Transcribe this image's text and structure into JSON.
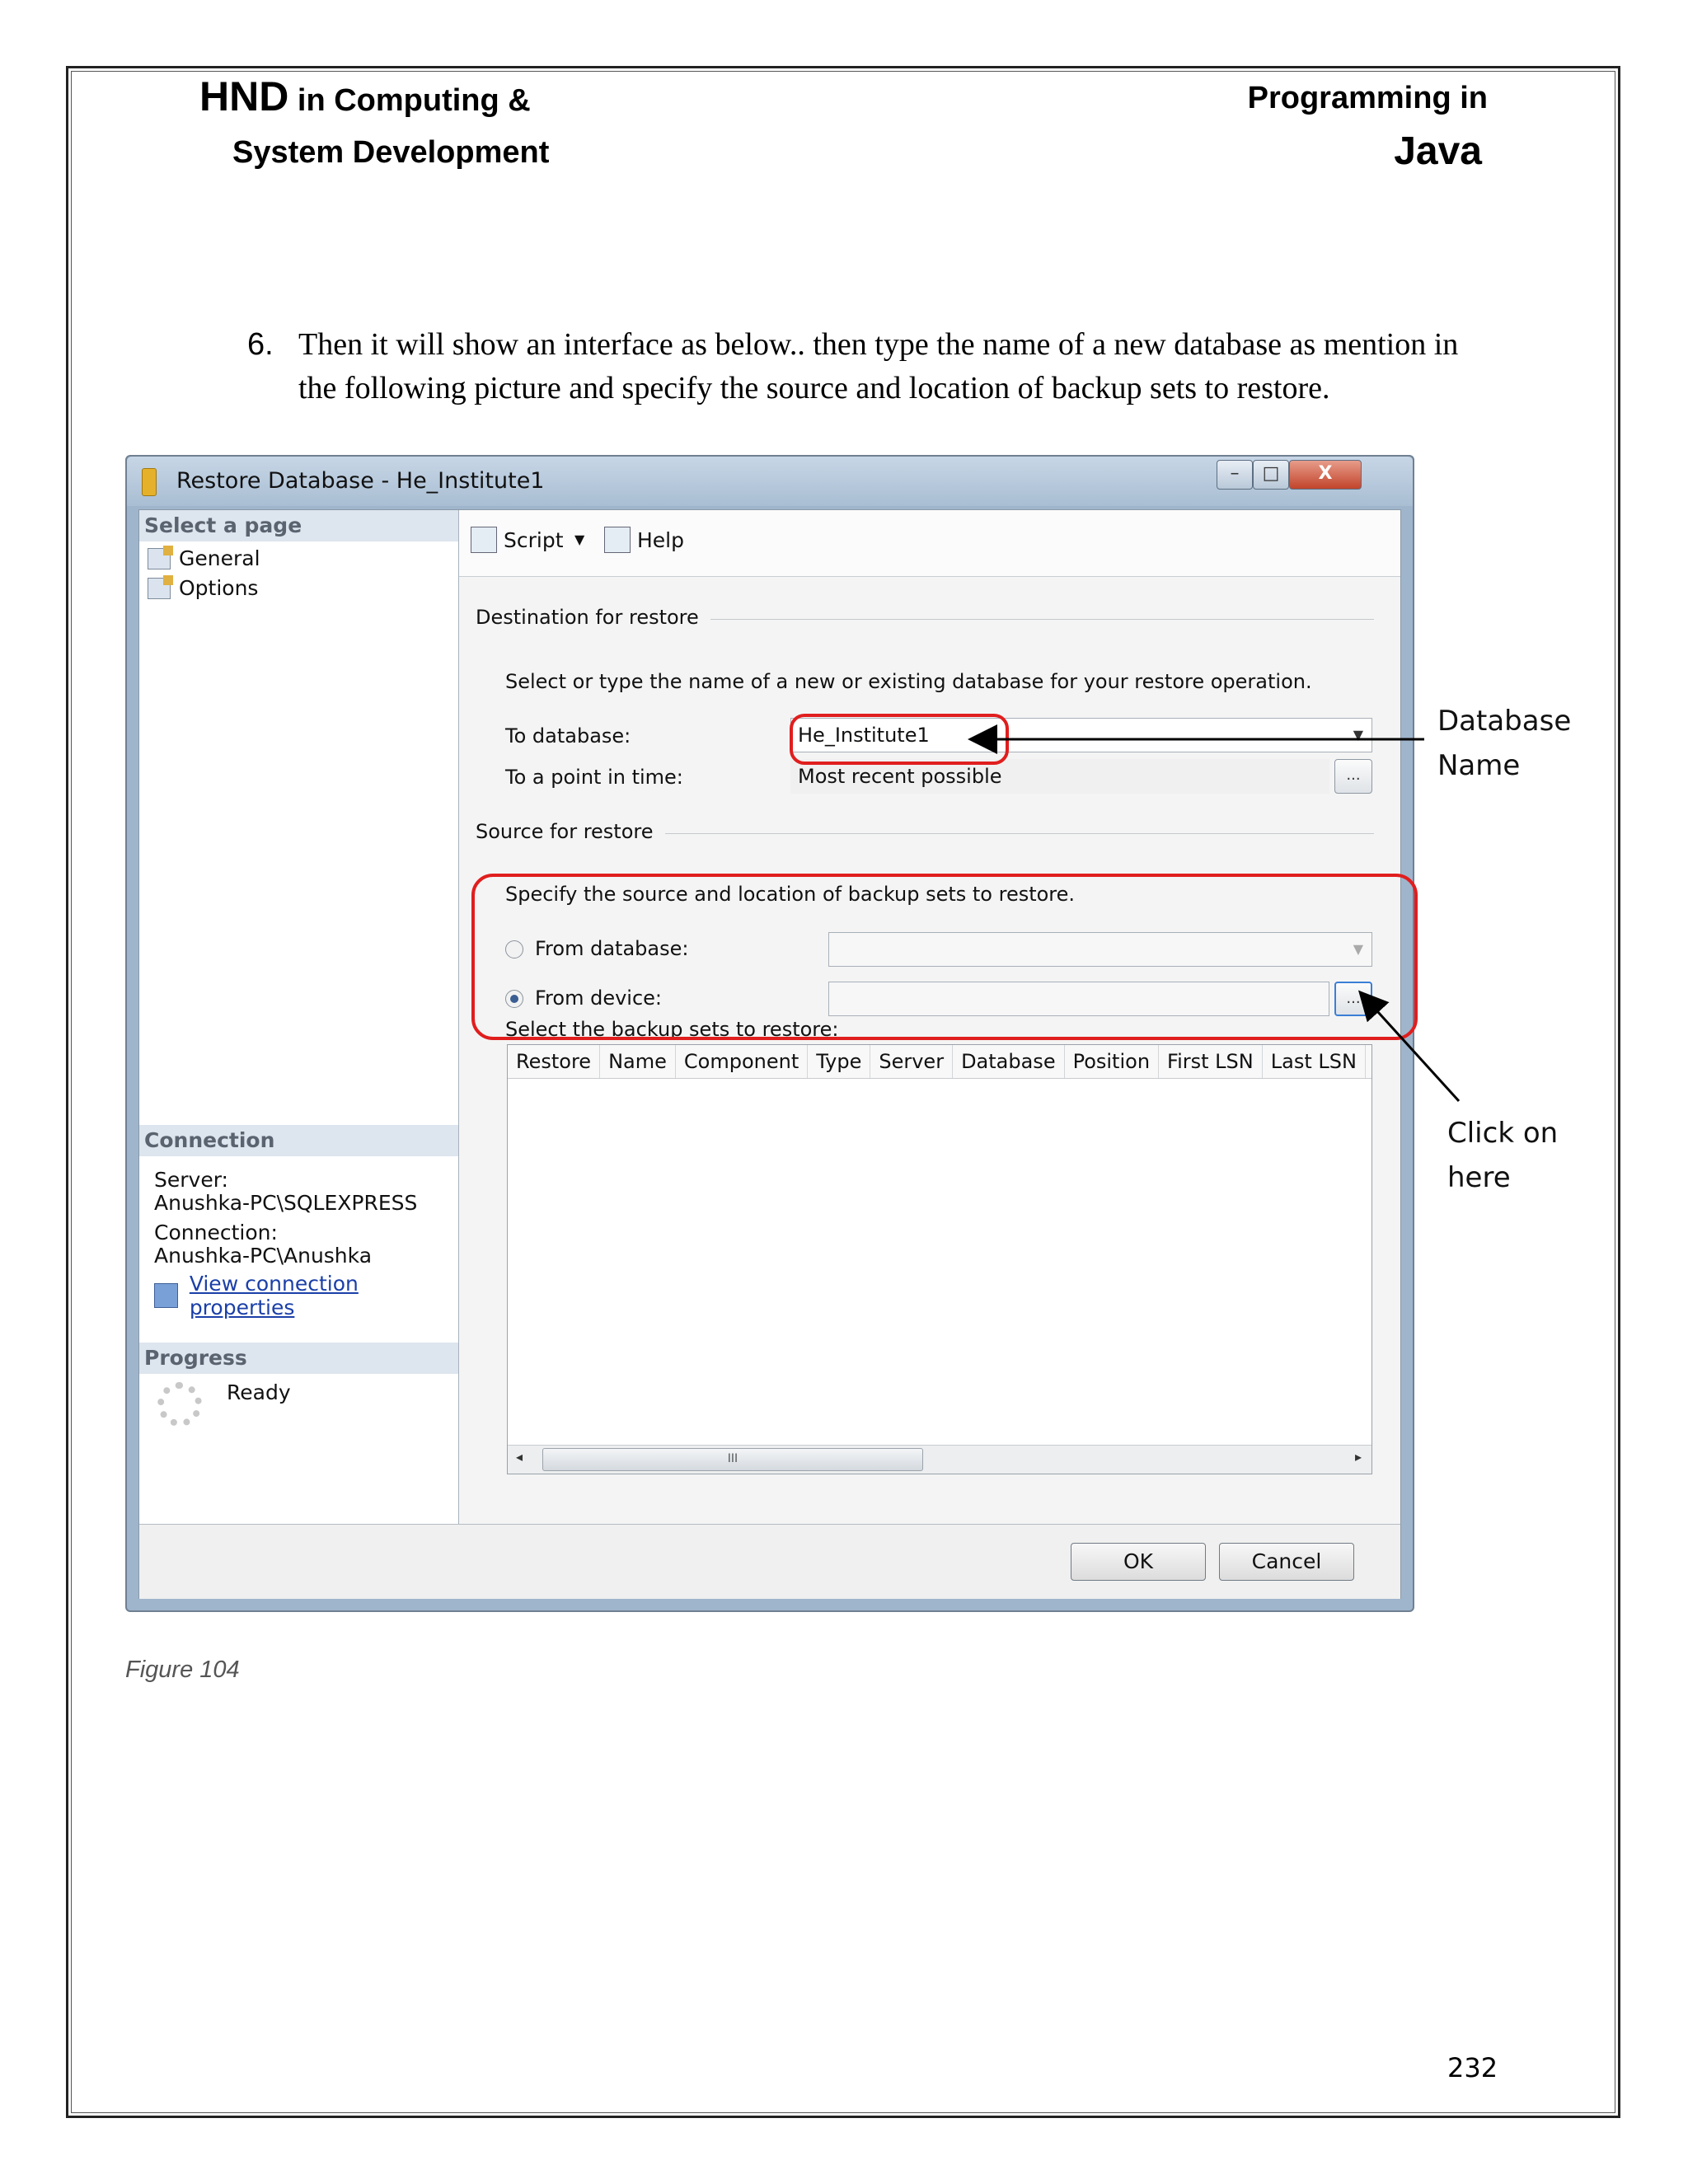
{
  "header": {
    "left_big": "HND",
    "left_line1": "in Computing &",
    "left_line2": "System Development",
    "right_line1": "Programming in",
    "right_line2": "Java"
  },
  "step": {
    "number": "6.",
    "text": "Then it will show an interface as below.. then type the name of a new database as mention in the following picture and specify the source and location of backup sets to restore."
  },
  "dialog": {
    "title": "Restore Database - He_Institute1",
    "window_buttons": {
      "min": "–",
      "max": "□",
      "close": "X"
    },
    "select_page": {
      "header": "Select a page",
      "items": [
        "General",
        "Options"
      ]
    },
    "connection": {
      "header": "Connection",
      "server_label": "Server:",
      "server_value": "Anushka-PC\\SQLEXPRESS",
      "connection_label": "Connection:",
      "connection_value": "Anushka-PC\\Anushka",
      "link": "View connection properties"
    },
    "progress": {
      "header": "Progress",
      "status": "Ready"
    },
    "toolbar": {
      "script": "Script",
      "dropdown": "▼",
      "help": "Help"
    },
    "destination": {
      "section": "Destination for restore",
      "instruction": "Select or type the name of a new or existing database for your restore operation.",
      "to_database_label": "To database:",
      "to_database_value": "He_Institute1",
      "point_in_time_label": "To a point in time:",
      "point_in_time_value": "Most recent possible",
      "ellipsis": "..."
    },
    "source": {
      "section": "Source for restore",
      "instruction": "Specify the source and location of backup sets to restore.",
      "from_database_label": "From database:",
      "from_device_label": "From device:",
      "selected": "from_device",
      "ellipsis": "..."
    },
    "backup_sets": {
      "label": "Select the backup sets to restore:",
      "columns": [
        "Restore",
        "Name",
        "Component",
        "Type",
        "Server",
        "Database",
        "Position",
        "First LSN",
        "Last LSN"
      ],
      "scroll_thumb": "III",
      "scroll_left": "◂",
      "scroll_right": "▸"
    },
    "buttons": {
      "ok": "OK",
      "cancel": "Cancel"
    }
  },
  "annotations": {
    "database_name": [
      "Database",
      "Name"
    ],
    "click_here": [
      "Click on",
      "here"
    ]
  },
  "caption": "Figure 104",
  "page_number": "232",
  "colors": {
    "highlight": "#e01e1e",
    "link": "#1a3fa8"
  }
}
